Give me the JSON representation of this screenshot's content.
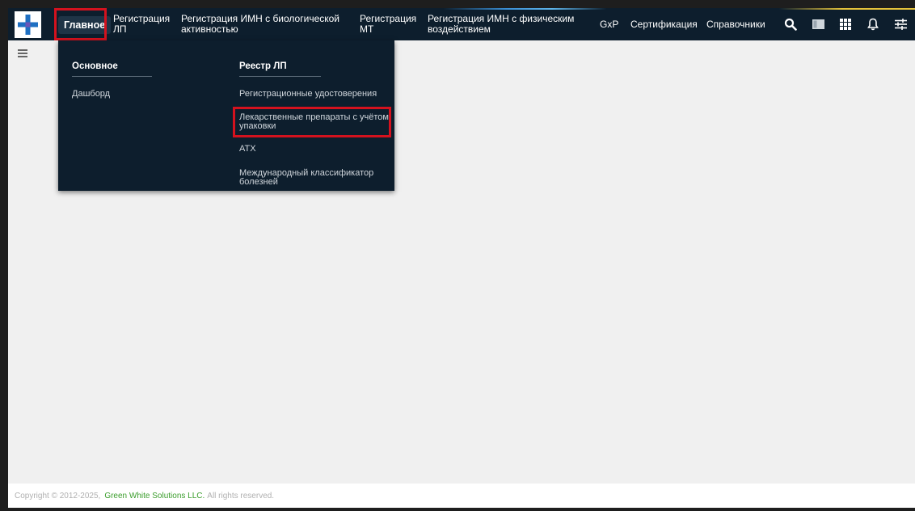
{
  "nav": {
    "items": [
      {
        "label": "Главное"
      },
      {
        "line1": "Регистрация",
        "line2": "ЛП"
      },
      {
        "line1": "Регистрация ИМН с биологической",
        "line2": "активностью"
      },
      {
        "line1": "Регистрация",
        "line2": "МТ"
      },
      {
        "line1": "Регистрация ИМН с физическим",
        "line2": "воздействием"
      },
      {
        "label": "GxP"
      },
      {
        "label": "Сертификация"
      },
      {
        "label": "Справочники"
      }
    ]
  },
  "icons": [
    "search-icon",
    "layout-icon",
    "grid-icon",
    "bell-icon",
    "settings-sliders-icon"
  ],
  "menu": {
    "col1": {
      "header": "Основное",
      "links": [
        "Дашборд"
      ]
    },
    "col2": {
      "header": "Реестр ЛП",
      "links": [
        {
          "line1": "Регистрационные удостоверения"
        },
        {
          "line1": "Лекарственные препараты с учётом",
          "line2": "упаковки"
        },
        {
          "line1": "АТХ"
        },
        {
          "line1": "Международный классификатор",
          "line2": "болезней"
        }
      ]
    }
  },
  "footer": {
    "copyright": "Copyright © 2012-2025,",
    "company": "Green White Solutions LLC.",
    "rights": "All rights reserved."
  },
  "colors": {
    "topbar": "#0d1e2d",
    "highlight": "#d4121e",
    "link": "#3a9d2b",
    "logo_cross": "#1e6fc2"
  }
}
